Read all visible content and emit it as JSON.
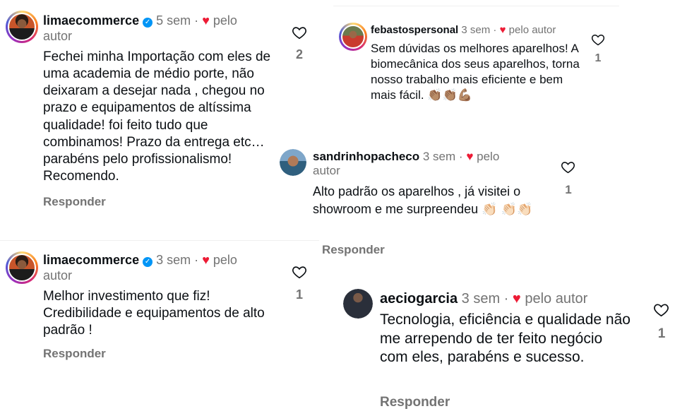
{
  "comments": [
    {
      "username": "limaecommerce",
      "time": "5 sem",
      "dot": "·",
      "author_like": "♥",
      "author_label": "pelo",
      "author_label2": "autor",
      "text": "Fechei minha Importação  com eles de uma academia de médio porte, não deixaram a desejar nada , chegou no prazo e equipamentos de altíssima qualidade! foi feito tudo que combinamos! Prazo da entrega etc… parabéns pelo profissionalismo! Recomendo.",
      "reply_label": "Responder",
      "likes": "2",
      "verified": "✓"
    },
    {
      "username": "febastospersonal",
      "time": "3 sem",
      "dot": "·",
      "author_like": "♥",
      "author_label": "pelo autor",
      "text": "Sem dúvidas os melhores aparelhos! A biomecânica dos seus aparelhos, torna nosso trabalho mais eficiente e bem mais fácil. 👏🏽👏🏽💪🏽",
      "likes": "1"
    },
    {
      "username": "sandrinhopacheco",
      "time": "3 sem",
      "dot": "·",
      "author_like": "♥",
      "author_label": "pelo",
      "author_label2": "autor",
      "text": "Alto padrão os aparelhos , já visitei o showroom e me surpreendeu 👏🏻 👏🏻👏🏻",
      "reply_label": "Responder",
      "likes": "1"
    },
    {
      "username": "limaecommerce",
      "time": "3 sem",
      "dot": "·",
      "author_like": "♥",
      "author_label": "pelo",
      "author_label2": "autor",
      "text": "Melhor investimento que fiz! Credibilidade e equipamentos de alto padrão !",
      "reply_label": "Responder",
      "likes": "1",
      "verified": "✓"
    },
    {
      "username": "aeciogarcia",
      "time": "3 sem",
      "dot": "·",
      "author_like": "♥",
      "author_label": "pelo autor",
      "text": "Tecnologia, eficiência e qualidade não me arrependo de ter feito negócio com eles, parabéns e sucesso.",
      "reply_label": "Responder",
      "likes": "1"
    }
  ],
  "colors": {
    "accent_heart": "#ed1b35",
    "verified": "#0095f6",
    "muted": "#737373"
  }
}
